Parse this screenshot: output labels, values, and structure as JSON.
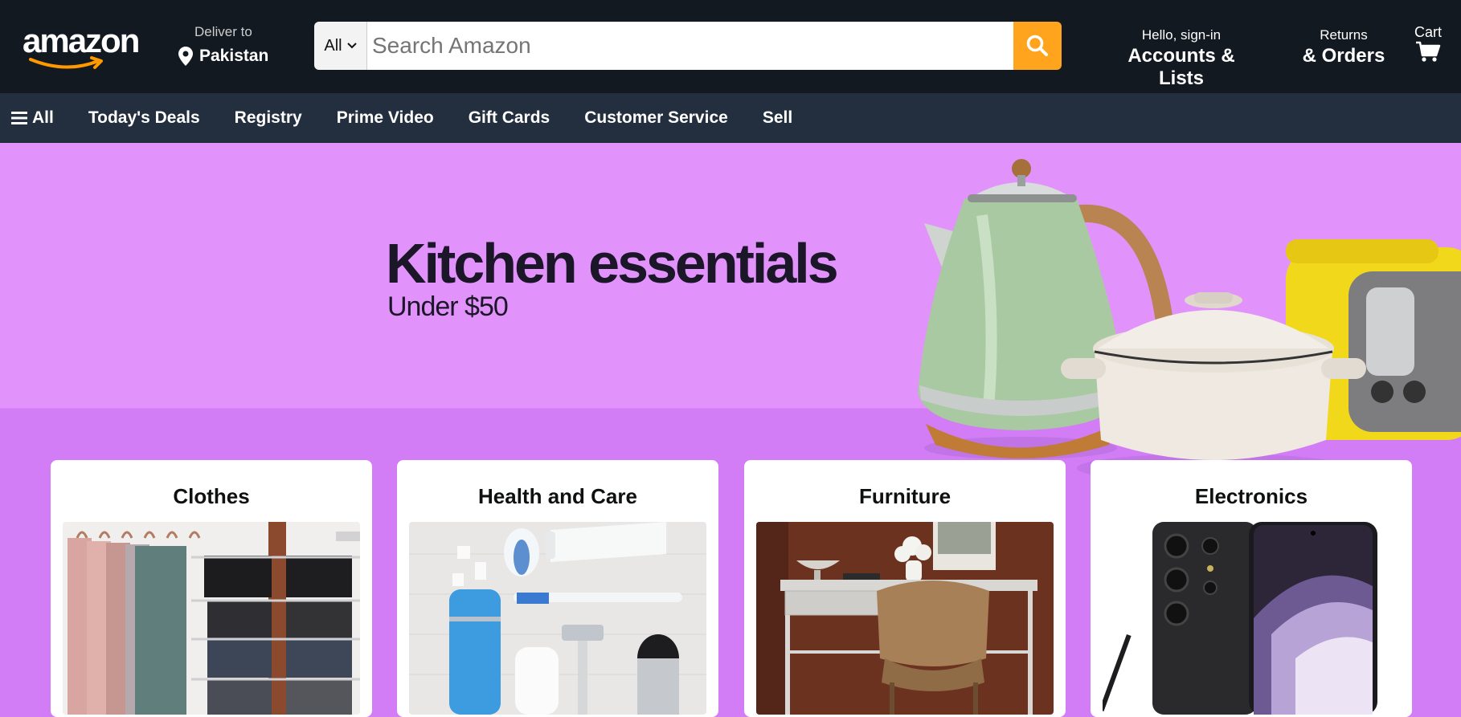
{
  "header": {
    "logo_text": "amazon",
    "deliver_label": "Deliver to",
    "deliver_location": "Pakistan",
    "search": {
      "category": "All",
      "placeholder": "Search Amazon"
    },
    "account": {
      "greeting": "Hello, sign-in",
      "label": "Accounts & Lists"
    },
    "returns": {
      "line1": "Returns",
      "line2": "& Orders"
    },
    "cart_label": "Cart"
  },
  "subnav": {
    "items": [
      {
        "label": "All",
        "icon": "hamburger-icon"
      },
      {
        "label": "Today's Deals"
      },
      {
        "label": "Registry"
      },
      {
        "label": "Prime Video"
      },
      {
        "label": "Gift Cards"
      },
      {
        "label": "Customer Service"
      },
      {
        "label": "Sell"
      }
    ]
  },
  "hero": {
    "title": "Kitchen essentials",
    "subtitle": "Under $50",
    "background_top": "#e293fb",
    "background_bottom": "#d27cf6"
  },
  "cards": [
    {
      "title": "Clothes"
    },
    {
      "title": "Health and Care"
    },
    {
      "title": "Furniture"
    },
    {
      "title": "Electronics"
    }
  ],
  "colors": {
    "topbar": "#131921",
    "subnav": "#232f3e",
    "search_button": "#ffa41c",
    "logo_smile": "#ff9900"
  }
}
